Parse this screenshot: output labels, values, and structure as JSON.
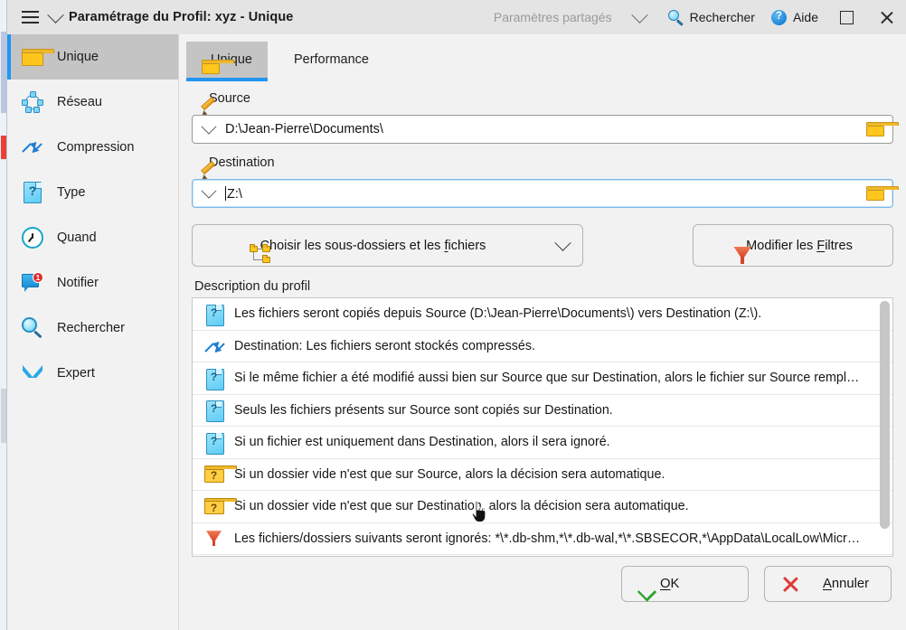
{
  "window": {
    "title": "Paramétrage du Profil: xyz - Unique",
    "menu_icon": "hamburger-icon",
    "title_dropdown_icon": "chevron-down-icon"
  },
  "titlebar_right": {
    "shared_settings_label": "Paramètres partagés",
    "shared_settings_chevron": "chevron-down-icon",
    "search_label": "Rechercher",
    "search_icon": "magnifier-icon",
    "help_label": "Aide",
    "help_icon": "help-circle-icon",
    "maximize_icon": "maximize-square-icon",
    "close_icon": "close-x-icon"
  },
  "sidebar": {
    "items": [
      {
        "label": "Unique",
        "icon": "folder-icon",
        "active": true
      },
      {
        "label": "Réseau",
        "icon": "network-icon",
        "active": false
      },
      {
        "label": "Compression",
        "icon": "compress-arrows-icon",
        "active": false
      },
      {
        "label": "Type",
        "icon": "document-question-icon",
        "active": false
      },
      {
        "label": "Quand",
        "icon": "clock-icon",
        "active": false
      },
      {
        "label": "Notifier",
        "icon": "notification-bubble-icon",
        "badge": "1",
        "active": false
      },
      {
        "label": "Rechercher",
        "icon": "magnifier-icon",
        "active": false
      },
      {
        "label": "Expert",
        "icon": "chevron-double-down-icon",
        "active": false
      }
    ]
  },
  "tabs": [
    {
      "label": "Unique",
      "icon": "folder-icon",
      "active": true
    },
    {
      "label": "Performance",
      "icon": "lightning-icon",
      "active": false
    }
  ],
  "source": {
    "label": "Source",
    "label_icon": "pencil-icon",
    "value": "D:\\Jean-Pierre\\Documents\\",
    "dropdown_icon": "chevron-down-icon",
    "browse_icon": "folder-icon"
  },
  "destination": {
    "label": "Destination",
    "label_icon": "pencil-icon",
    "value": "Z:\\",
    "dropdown_icon": "chevron-down-icon",
    "browse_icon": "folder-icon",
    "focused": true
  },
  "actions": {
    "choose_prefix": "Choisir les sous-dossiers et les ",
    "choose_accel": "f",
    "choose_suffix": "ichiers",
    "choose_icon": "folder-tree-icon",
    "choose_chevron": "chevron-down-icon",
    "filters_prefix": "Modifier les ",
    "filters_accel": "F",
    "filters_suffix": "iltres",
    "filters_icon": "funnel-icon"
  },
  "description": {
    "label": "Description du profil",
    "rows": [
      {
        "icon": "document-question-icon",
        "text": "Les fichiers seront copiés depuis Source (D:\\Jean-Pierre\\Documents\\) vers Destination (Z:\\)."
      },
      {
        "icon": "compress-arrows-icon",
        "text": "Destination: Les fichiers seront stockés compressés."
      },
      {
        "icon": "document-question-icon",
        "text": "Si le même fichier a été modifié aussi bien sur Source que sur Destination, alors le fichier sur Source remplac…"
      },
      {
        "icon": "document-question-icon",
        "text": "Seuls les fichiers présents sur Source sont copiés sur Destination."
      },
      {
        "icon": "document-question-icon",
        "text": "Si un fichier est uniquement dans Destination, alors il sera ignoré."
      },
      {
        "icon": "folder-question-icon",
        "text": "Si un dossier vide n'est que sur Source, alors la décision sera automatique."
      },
      {
        "icon": "folder-question-icon",
        "text": "Si un dossier vide n'est que sur Destination, alors la décision sera automatique."
      },
      {
        "icon": "funnel-icon",
        "text": "Les fichiers/dossiers suivants seront ignorés: *\\*.db-shm,*\\*.db-wal,*\\*.SBSECOR,*\\AppData\\LocalLow\\Micros…"
      }
    ]
  },
  "footer": {
    "ok_accel": "O",
    "ok_suffix": "K",
    "ok_icon": "green-check-icon",
    "cancel_accel": "A",
    "cancel_suffix": "nnuler",
    "cancel_icon": "red-x-icon"
  },
  "colors": {
    "accent_blue": "#2196f3",
    "selection_gray": "#c4c4c4",
    "window_bg": "#f2f2f2",
    "titlebar_bg": "#e4e4e4",
    "folder_yellow": "#ffc61e",
    "funnel_orange": "#d9442a",
    "badge_red": "#e02a2a",
    "check_green": "#2ea02e",
    "x_red": "#e03b3b"
  }
}
